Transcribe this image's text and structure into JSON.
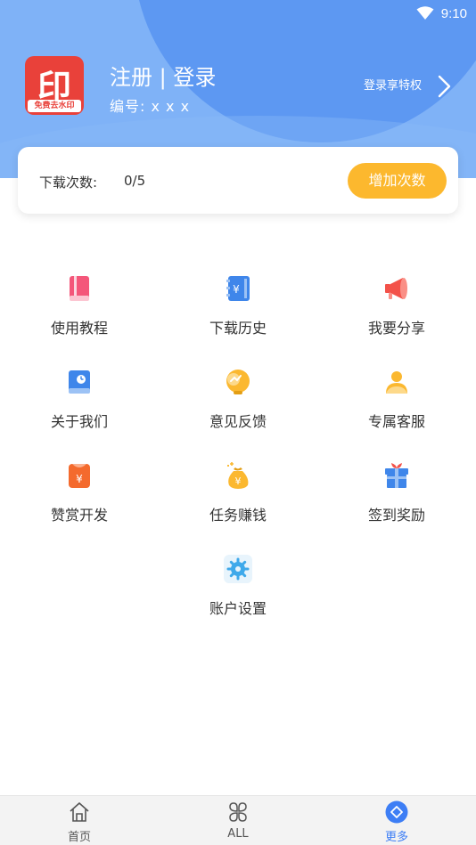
{
  "status_bar": {
    "time": "9:10"
  },
  "header": {
    "logo_glyph": "印",
    "logo_band_text": "免费去水印",
    "login_title": "注册 | 登录",
    "user_id_text": "编号:  x x x",
    "privilege_text": "登录享特权"
  },
  "downloads": {
    "label": "下载次数:",
    "value": "0/5",
    "add_button": "增加次数"
  },
  "menu": [
    {
      "label": "使用教程",
      "icon": "tutorial-book-icon",
      "color": "#f4577a"
    },
    {
      "label": "下载历史",
      "icon": "download-history-icon",
      "color": "#3f86ea"
    },
    {
      "label": "我要分享",
      "icon": "megaphone-share-icon",
      "color": "#f3524a"
    },
    {
      "label": "关于我们",
      "icon": "about-us-icon",
      "color": "#3f86ea"
    },
    {
      "label": "意见反馈",
      "icon": "feedback-icon",
      "color": "#fbb830"
    },
    {
      "label": "专属客服",
      "icon": "customer-service-icon",
      "color": "#fbb830"
    },
    {
      "label": "赞赏开发",
      "icon": "reward-developer-icon",
      "color": "#f46a2d"
    },
    {
      "label": "任务赚钱",
      "icon": "task-money-bag-icon",
      "color": "#fbb830"
    },
    {
      "label": "签到奖励",
      "icon": "sign-in-gift-icon",
      "color": "#3f86ea"
    },
    {
      "label": "账户设置",
      "icon": "account-settings-icon",
      "color": "#3fa9ea"
    }
  ],
  "bottom_nav": [
    {
      "label": "首页",
      "icon": "home-icon"
    },
    {
      "label": "ALL",
      "icon": "all-categories-icon"
    },
    {
      "label": "更多",
      "icon": "more-icon",
      "active": true
    }
  ],
  "colors": {
    "header_bg": "#7fb2f7",
    "accent_blue": "#3d7ef5",
    "button_orange": "#fcb82e"
  }
}
